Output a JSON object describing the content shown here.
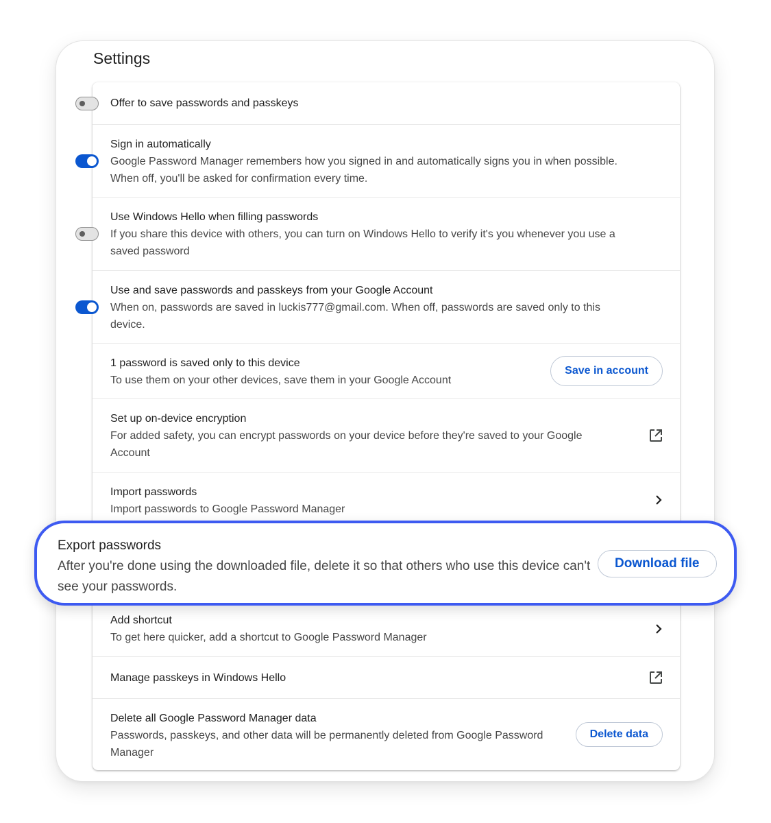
{
  "page": {
    "title": "Settings"
  },
  "rows": {
    "offer_save": {
      "label": "Offer to save passwords and passkeys",
      "toggle": "off"
    },
    "sign_in": {
      "label": "Sign in automatically",
      "sub": "Google Password Manager remembers how you signed in and automatically signs you in when possible. When off, you'll be asked for confirmation every time.",
      "toggle": "on"
    },
    "windows_hello": {
      "label": "Use Windows Hello when filling passwords",
      "sub": "If you share this device with others, you can turn on Windows Hello to verify it's you whenever you use a saved password",
      "toggle": "off"
    },
    "google_account": {
      "label": "Use and save passwords and passkeys from your Google Account",
      "sub": "When on, passwords are saved in luckis777@gmail.com. When off, passwords are saved only to this device.",
      "toggle": "on"
    },
    "saved_device": {
      "label": "1 password is saved only to this device",
      "sub": "To use them on your other devices, save them in your Google Account",
      "button": "Save in account"
    },
    "encryption": {
      "label": "Set up on-device encryption",
      "sub": "For added safety, you can encrypt passwords on your device before they're saved to your Google Account",
      "icon": "open-in-new-icon"
    },
    "import": {
      "label": "Import passwords",
      "sub": "Import passwords to Google Password Manager",
      "icon": "chevron-right-icon"
    },
    "export": {
      "label": "Export passwords",
      "sub": "After you're done using the downloaded file, delete it so that others who use this device can't see your passwords.",
      "button": "Download file"
    },
    "shortcut": {
      "label": "Add shortcut",
      "sub": "To get here quicker, add a shortcut to Google Password Manager",
      "icon": "chevron-right-icon"
    },
    "manage_passkeys": {
      "label": "Manage passkeys in Windows Hello",
      "icon": "open-in-new-icon"
    },
    "delete_data": {
      "label": "Delete all Google Password Manager data",
      "sub": "Passwords, passkeys, and other data will be permanently deleted from Google Password Manager",
      "button": "Delete data"
    }
  },
  "colors": {
    "accent": "#0b57d0",
    "highlight_border": "#3d5af1"
  }
}
